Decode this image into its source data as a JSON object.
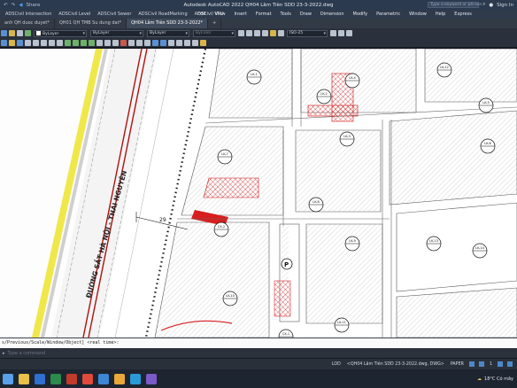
{
  "titlebar": {
    "share_label": "Share",
    "title": "Autodesk AutoCAD 2022   QH04 Lâm Tiên SDD 23-3-2022.dwg",
    "search_placeholder": "Type a keyword or phrase",
    "signin_label": "Sign In"
  },
  "ribbon_tabs": [
    "ADSCivil Intersection",
    "ADSCivil Level",
    "ADSCivil Sewer",
    "ADSCivil RoadMarking",
    "ADSCivil VPV"
  ],
  "menus": [
    "Edit",
    "View",
    "Insert",
    "Format",
    "Tools",
    "Draw",
    "Dimension",
    "Modify",
    "Parametric",
    "Window",
    "Help",
    "Express"
  ],
  "doc_tabs": [
    {
      "label": "anh QH duoc duyet*",
      "active": false
    },
    {
      "label": "QH01 QH TMB Su dung dat*",
      "active": false
    },
    {
      "label": "QH04 Lâm Tiên SDD 23-3-2022*",
      "active": true
    }
  ],
  "toolbar": {
    "layer_value": "ByLayer",
    "linetype_value": "ByLayer",
    "lineweight_value": "ByLayer",
    "plotstyle_value": "ByColor",
    "dimstyle_value": "ISO-25"
  },
  "drawing": {
    "road_label": "ĐƯỜNG SẮT HÀ NỘI - THÁI NGUYÊN",
    "dimension_label": "29",
    "parking_label": "P",
    "lot_labels": [
      "LK-1",
      "LK-2",
      "LK-3",
      "LK-4",
      "LK-5",
      "LK-6",
      "LK-7",
      "LK-8",
      "LK-9",
      "LK-10",
      "LK-11",
      "LK-12",
      "LK-13",
      "LK-14",
      "CX-1",
      "CX-2"
    ]
  },
  "command": {
    "history": "s/Previous/Scale/Window/Object] <real time>:",
    "prompt": "Type a command"
  },
  "statusbar": {
    "layout_label": "LOD",
    "file_label": "<QH04 Lâm Tiên SDD 23-3-2022.dwg, DWG>",
    "paper_label": "PAPER",
    "scale_label": "1"
  },
  "taskbar": {
    "weather": "18°C  Có mây"
  },
  "colors": {
    "accent": "#d81e1e",
    "road_yellow": "#f0e84a",
    "rail_red": "#b01010"
  }
}
